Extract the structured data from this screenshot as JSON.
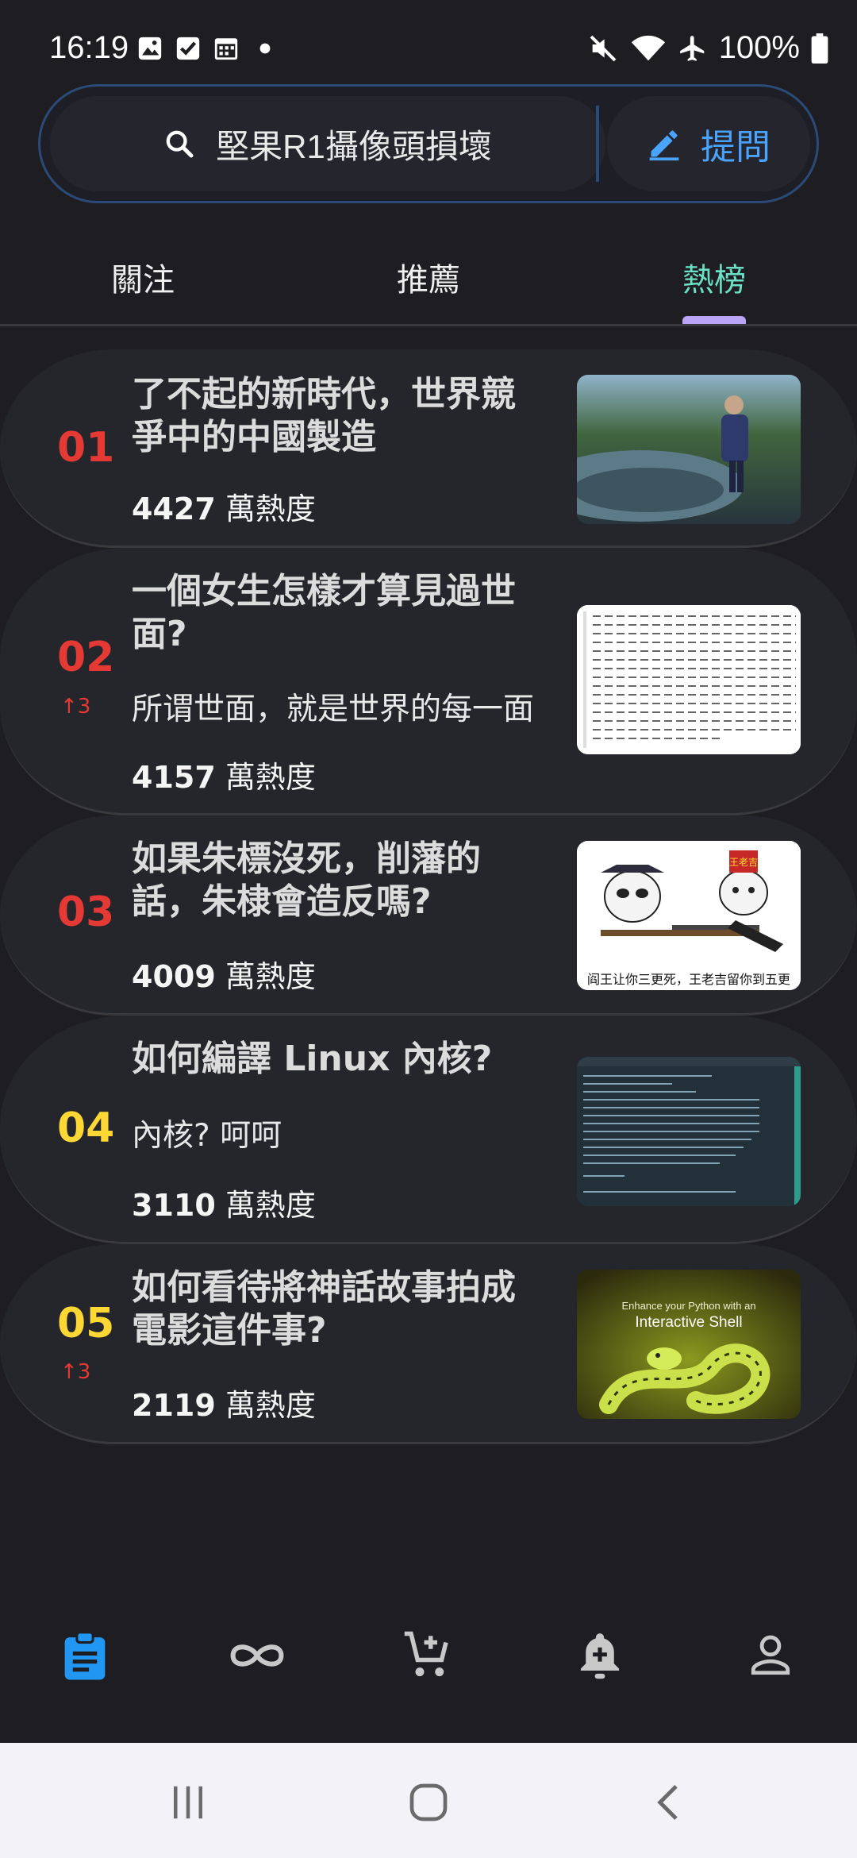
{
  "status_bar": {
    "time": "16:19",
    "left_icons": [
      "image-icon",
      "checkbox-icon",
      "calendar-icon",
      "dot-icon"
    ],
    "right_icons": [
      "mute-icon",
      "wifi-icon",
      "airplane-icon",
      "battery-icon"
    ],
    "battery": "100%"
  },
  "search": {
    "query": "堅果R1攝像頭損壞",
    "ask_label": "提問"
  },
  "tabs": [
    {
      "label": "關注",
      "active": false
    },
    {
      "label": "推薦",
      "active": false
    },
    {
      "label": "熱榜",
      "active": true
    }
  ],
  "hot_list": [
    {
      "rank": "01",
      "delta": "",
      "title": "了不起的新時代，世界競爭中的中國製造",
      "excerpt": "",
      "heat_value": "4427",
      "heat_unit": "萬熱度",
      "rank_color": "#e53935",
      "thumb": "radio-telescope-photo"
    },
    {
      "rank": "02",
      "delta": "↑3",
      "title": "一個女生怎樣才算見過世面?",
      "excerpt": "所谓世面，就是世界的每一面",
      "heat_value": "4157",
      "heat_unit": "萬熱度",
      "rank_color": "#e53935",
      "thumb": "text-grid-image"
    },
    {
      "rank": "03",
      "delta": "",
      "title": "如果朱標沒死，削藩的話，朱棣會造反嗎?",
      "excerpt": "",
      "heat_value": "4009",
      "heat_unit": "萬熱度",
      "rank_color": "#e53935",
      "thumb": "meme-image",
      "thumb_caption": "阎王让你三更死，王老吉留你到五更",
      "thumb_badge": "王老吉"
    },
    {
      "rank": "04",
      "delta": "",
      "title": "如何編譯 Linux 內核?",
      "excerpt": "內核? 呵呵",
      "heat_value": "3110",
      "heat_unit": "萬熱度",
      "rank_color": "#fdd835",
      "thumb": "terminal-screenshot"
    },
    {
      "rank": "05",
      "delta": "↑3",
      "title": "如何看待將神話故事拍成電影這件事?",
      "excerpt": "",
      "heat_value": "2119",
      "heat_unit": "萬熱度",
      "rank_color": "#fdd835",
      "thumb": "python-snake-image",
      "thumb_line1": "Enhance your Python with an",
      "thumb_line2": "Interactive Shell"
    }
  ],
  "bottom_nav": [
    "clipboard-icon",
    "infinity-icon",
    "cart-add-icon",
    "bell-add-icon",
    "person-icon"
  ],
  "colors": {
    "accent": "#4aa3ff",
    "active_tab": "#6be0c4",
    "indicator": "#b9a4f5",
    "rank_top": "#e53935",
    "rank_mid": "#fdd835"
  }
}
